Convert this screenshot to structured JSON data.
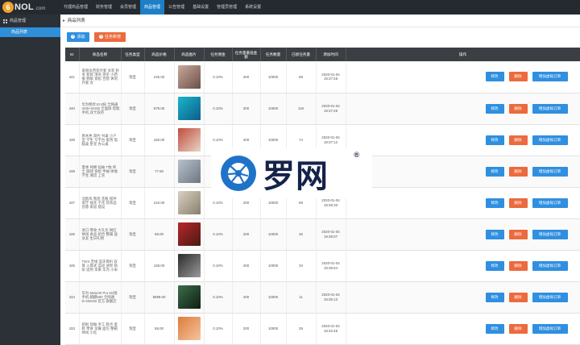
{
  "app": {
    "logo_badge": "6",
    "logo_text": "NOL",
    "logo_suffix": ".com"
  },
  "topnav": [
    {
      "label": "代理商品管理",
      "active": false
    },
    {
      "label": "财务管理",
      "active": false
    },
    {
      "label": "会员管理",
      "active": false
    },
    {
      "label": "商品管理",
      "active": true
    },
    {
      "label": "公告管理",
      "active": false
    },
    {
      "label": "基础设置",
      "active": false
    },
    {
      "label": "管理员管理",
      "active": false
    },
    {
      "label": "系统设置",
      "active": false
    }
  ],
  "sidebar": {
    "group_label": "商品管理",
    "items": [
      {
        "label": "商品列表",
        "active": true
      }
    ]
  },
  "main": {
    "title": "商品列表",
    "add_label": "添加",
    "task_label": "任务新增"
  },
  "table": {
    "headers": [
      "ID",
      "商品名称",
      "任务类型",
      "商品价格",
      "商品图片",
      "任务佣金",
      "任务量最低金额",
      "任务数量",
      "已接任务量",
      "添加时间",
      "操作"
    ],
    "ops": {
      "edit": "修改",
      "delete": "删除",
      "add_order": "增加虚拟订单"
    },
    "rows": [
      {
        "id": "441",
        "name": "爱丽舍西装外套 女装 秋冬 新款 港风 英伦 小西服 韩版 宽松 百搭 休闲 外套 女",
        "type": "淘宝",
        "price": "245.00",
        "rate": "0.10%",
        "min": "200",
        "count": "10000",
        "taken": "68",
        "date": "2020-01-04",
        "time": "19:37:48",
        "img_a": "#c9a89a",
        "img_b": "#6b4f49"
      },
      {
        "id": "440",
        "name": "华为畅享10 8核 全网通 4GB+64GB 全面屏 智能手机 双卡双待",
        "type": "淘宝",
        "price": "879.00",
        "rate": "0.10%",
        "min": "200",
        "count": "10000",
        "taken": "119",
        "date": "2020-01-04",
        "time": "19:37:29",
        "img_a": "#1bb6c9",
        "img_b": "#0d5d8a"
      },
      {
        "id": "439",
        "name": "原木色 简约 书桌 小户型 学生 写字台 家用 电脑桌 卧室 办公桌",
        "type": "淘宝",
        "price": "150.00",
        "rate": "0.10%",
        "min": "200",
        "count": "10000",
        "taken": "74",
        "date": "2020-01-04",
        "time": "19:37:12",
        "img_a": "#c14b3c",
        "img_b": "#e8d5c5"
      },
      {
        "id": "438",
        "name": "夏季 纯棉 短袖 T恤 男士 圆领 宽松 半袖 体恤 学生 潮流 上衣",
        "type": "淘宝",
        "price": "77.50",
        "rate": "0.10%",
        "min": "200",
        "count": "10000",
        "taken": "52",
        "date": "2020-01-04",
        "time": "19:36:50",
        "img_a": "#b9c2cc",
        "img_b": "#6d7681"
      },
      {
        "id": "437",
        "name": "北欧风 陶瓷 花瓶 摆件 客厅 插花 干花 装饰品 创意 家居 摆设",
        "type": "淘宝",
        "price": "210.00",
        "rate": "0.10%",
        "min": "200",
        "count": "10000",
        "taken": "88",
        "date": "2020-01-04",
        "time": "19:36:33",
        "img_a": "#d8d2c4",
        "img_b": "#8a7e6a"
      },
      {
        "id": "436",
        "name": "进口 零食 大礼包 网红 休闲 食品 组合 整箱 送女友 生日礼物",
        "type": "淘宝",
        "price": "58.00",
        "rate": "0.10%",
        "min": "200",
        "count": "10000",
        "taken": "46",
        "date": "2020-01-04",
        "time": "19:36:07",
        "img_a": "#b8262a",
        "img_b": "#4a1a14"
      },
      {
        "id": "435",
        "name": "TWS 无线 蓝牙耳机 双耳 入耳式 运动 迷你 隐形 适用 苹果 华为 小米",
        "type": "淘宝",
        "price": "168.00",
        "rate": "0.10%",
        "min": "200",
        "count": "10000",
        "taken": "34",
        "date": "2020-01-04",
        "time": "19:35:54",
        "img_a": "#2b2b2b",
        "img_b": "#9a9a9a"
      },
      {
        "id": "434",
        "name": "华为 Mate30 Pro 5G版 手机 麒麟990 全网通 8+256GB 官方 旗舰店",
        "type": "淘宝",
        "price": "5999.00",
        "rate": "0.10%",
        "min": "200",
        "count": "10000",
        "taken": "11",
        "date": "2020-01-04",
        "time": "19:35:13",
        "img_a": "#3c6e4a",
        "img_b": "#0f1d14"
      },
      {
        "id": "433",
        "name": "新鲜 现做 手工 糕点 蛋糕 零食 早餐 面包 整箱 休闲 小吃",
        "type": "淘宝",
        "price": "58.00",
        "rate": "0.10%",
        "min": "200",
        "count": "10000",
        "taken": "29",
        "date": "2020-01-04",
        "time": "19:32:48",
        "img_a": "#e07a3c",
        "img_b": "#f2c6a0"
      }
    ]
  },
  "watermark": {
    "text": "罗网",
    "reg": "®",
    "ring_color": "#1e73c8"
  }
}
